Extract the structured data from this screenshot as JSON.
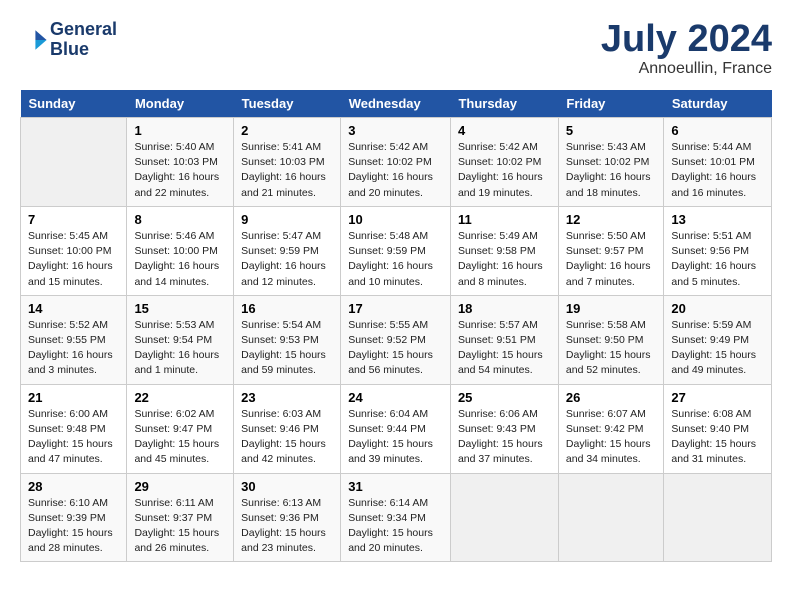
{
  "logo": {
    "line1": "General",
    "line2": "Blue"
  },
  "title": "July 2024",
  "location": "Annoeullin, France",
  "header_days": [
    "Sunday",
    "Monday",
    "Tuesday",
    "Wednesday",
    "Thursday",
    "Friday",
    "Saturday"
  ],
  "weeks": [
    [
      {
        "day": "",
        "info": ""
      },
      {
        "day": "1",
        "info": "Sunrise: 5:40 AM\nSunset: 10:03 PM\nDaylight: 16 hours\nand 22 minutes."
      },
      {
        "day": "2",
        "info": "Sunrise: 5:41 AM\nSunset: 10:03 PM\nDaylight: 16 hours\nand 21 minutes."
      },
      {
        "day": "3",
        "info": "Sunrise: 5:42 AM\nSunset: 10:02 PM\nDaylight: 16 hours\nand 20 minutes."
      },
      {
        "day": "4",
        "info": "Sunrise: 5:42 AM\nSunset: 10:02 PM\nDaylight: 16 hours\nand 19 minutes."
      },
      {
        "day": "5",
        "info": "Sunrise: 5:43 AM\nSunset: 10:02 PM\nDaylight: 16 hours\nand 18 minutes."
      },
      {
        "day": "6",
        "info": "Sunrise: 5:44 AM\nSunset: 10:01 PM\nDaylight: 16 hours\nand 16 minutes."
      }
    ],
    [
      {
        "day": "7",
        "info": "Sunrise: 5:45 AM\nSunset: 10:00 PM\nDaylight: 16 hours\nand 15 minutes."
      },
      {
        "day": "8",
        "info": "Sunrise: 5:46 AM\nSunset: 10:00 PM\nDaylight: 16 hours\nand 14 minutes."
      },
      {
        "day": "9",
        "info": "Sunrise: 5:47 AM\nSunset: 9:59 PM\nDaylight: 16 hours\nand 12 minutes."
      },
      {
        "day": "10",
        "info": "Sunrise: 5:48 AM\nSunset: 9:59 PM\nDaylight: 16 hours\nand 10 minutes."
      },
      {
        "day": "11",
        "info": "Sunrise: 5:49 AM\nSunset: 9:58 PM\nDaylight: 16 hours\nand 8 minutes."
      },
      {
        "day": "12",
        "info": "Sunrise: 5:50 AM\nSunset: 9:57 PM\nDaylight: 16 hours\nand 7 minutes."
      },
      {
        "day": "13",
        "info": "Sunrise: 5:51 AM\nSunset: 9:56 PM\nDaylight: 16 hours\nand 5 minutes."
      }
    ],
    [
      {
        "day": "14",
        "info": "Sunrise: 5:52 AM\nSunset: 9:55 PM\nDaylight: 16 hours\nand 3 minutes."
      },
      {
        "day": "15",
        "info": "Sunrise: 5:53 AM\nSunset: 9:54 PM\nDaylight: 16 hours\nand 1 minute."
      },
      {
        "day": "16",
        "info": "Sunrise: 5:54 AM\nSunset: 9:53 PM\nDaylight: 15 hours\nand 59 minutes."
      },
      {
        "day": "17",
        "info": "Sunrise: 5:55 AM\nSunset: 9:52 PM\nDaylight: 15 hours\nand 56 minutes."
      },
      {
        "day": "18",
        "info": "Sunrise: 5:57 AM\nSunset: 9:51 PM\nDaylight: 15 hours\nand 54 minutes."
      },
      {
        "day": "19",
        "info": "Sunrise: 5:58 AM\nSunset: 9:50 PM\nDaylight: 15 hours\nand 52 minutes."
      },
      {
        "day": "20",
        "info": "Sunrise: 5:59 AM\nSunset: 9:49 PM\nDaylight: 15 hours\nand 49 minutes."
      }
    ],
    [
      {
        "day": "21",
        "info": "Sunrise: 6:00 AM\nSunset: 9:48 PM\nDaylight: 15 hours\nand 47 minutes."
      },
      {
        "day": "22",
        "info": "Sunrise: 6:02 AM\nSunset: 9:47 PM\nDaylight: 15 hours\nand 45 minutes."
      },
      {
        "day": "23",
        "info": "Sunrise: 6:03 AM\nSunset: 9:46 PM\nDaylight: 15 hours\nand 42 minutes."
      },
      {
        "day": "24",
        "info": "Sunrise: 6:04 AM\nSunset: 9:44 PM\nDaylight: 15 hours\nand 39 minutes."
      },
      {
        "day": "25",
        "info": "Sunrise: 6:06 AM\nSunset: 9:43 PM\nDaylight: 15 hours\nand 37 minutes."
      },
      {
        "day": "26",
        "info": "Sunrise: 6:07 AM\nSunset: 9:42 PM\nDaylight: 15 hours\nand 34 minutes."
      },
      {
        "day": "27",
        "info": "Sunrise: 6:08 AM\nSunset: 9:40 PM\nDaylight: 15 hours\nand 31 minutes."
      }
    ],
    [
      {
        "day": "28",
        "info": "Sunrise: 6:10 AM\nSunset: 9:39 PM\nDaylight: 15 hours\nand 28 minutes."
      },
      {
        "day": "29",
        "info": "Sunrise: 6:11 AM\nSunset: 9:37 PM\nDaylight: 15 hours\nand 26 minutes."
      },
      {
        "day": "30",
        "info": "Sunrise: 6:13 AM\nSunset: 9:36 PM\nDaylight: 15 hours\nand 23 minutes."
      },
      {
        "day": "31",
        "info": "Sunrise: 6:14 AM\nSunset: 9:34 PM\nDaylight: 15 hours\nand 20 minutes."
      },
      {
        "day": "",
        "info": ""
      },
      {
        "day": "",
        "info": ""
      },
      {
        "day": "",
        "info": ""
      }
    ]
  ]
}
